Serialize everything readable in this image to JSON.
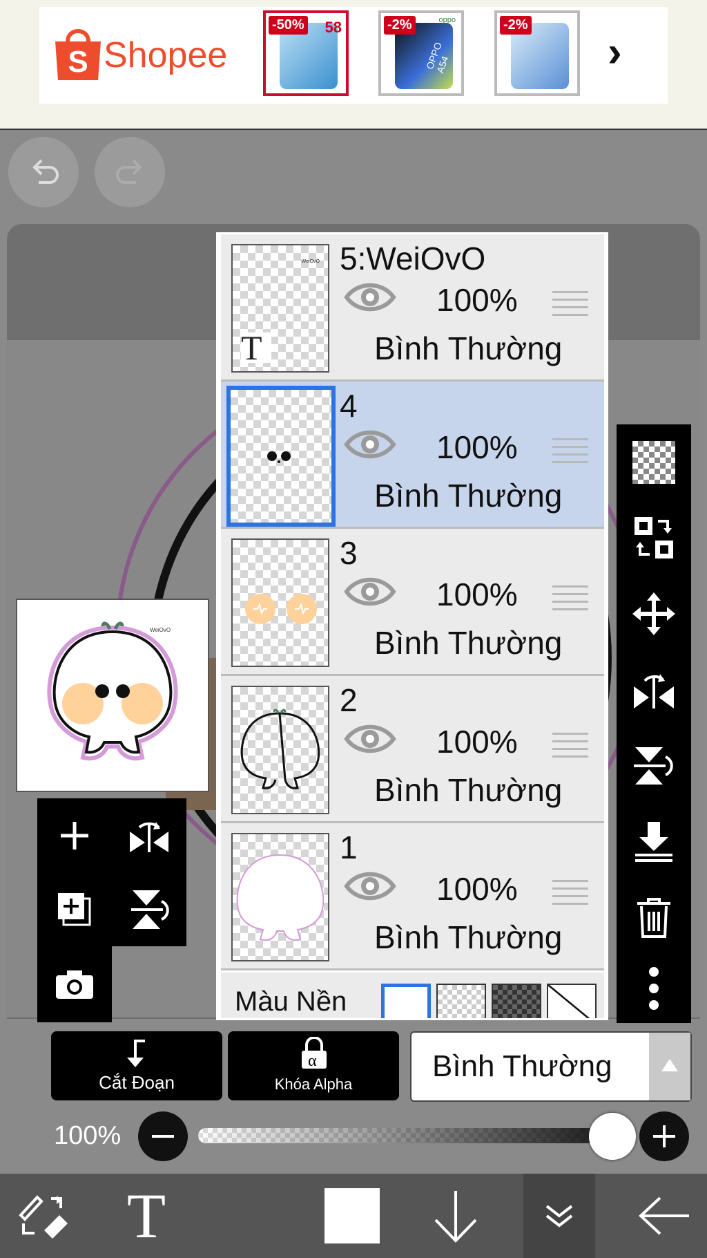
{
  "ad": {
    "brand": "Shopee",
    "items": [
      {
        "discount": "-50%",
        "price": "58"
      },
      {
        "discount": "-2%",
        "model": "OPPO A54",
        "brand_mark": "oppo"
      },
      {
        "discount": "-2%"
      }
    ],
    "next_icon": "chevron-right-icon"
  },
  "toolbar_top": {
    "undo_icon": "undo-icon",
    "redo_icon": "redo-icon"
  },
  "layers": [
    {
      "name": "5:WeiOvO",
      "opacity": "100%",
      "blend": "Bình Thường",
      "visible": true,
      "selected": false,
      "type_icon": "T",
      "thumb_text": "WeiOvO"
    },
    {
      "name": "4",
      "opacity": "100%",
      "blend": "Bình Thường",
      "visible": true,
      "selected": true
    },
    {
      "name": "3",
      "opacity": "100%",
      "blend": "Bình Thường",
      "visible": true,
      "selected": false
    },
    {
      "name": "2",
      "opacity": "100%",
      "blend": "Bình Thường",
      "visible": true,
      "selected": false
    },
    {
      "name": "1",
      "opacity": "100%",
      "blend": "Bình Thường",
      "visible": true,
      "selected": false
    }
  ],
  "background": {
    "label": "Màu Nền"
  },
  "preview": {
    "text": "WeiOvO"
  },
  "bottom_controls": {
    "clip_label": "Cắt Đoạn",
    "alpha_lock_label": "Khóa Alpha",
    "alpha_symbol": "α",
    "blend_mode": "Bình Thường"
  },
  "opacity": {
    "value_text": "100%",
    "value": 1.0
  },
  "colors": {
    "selected_layer_bg": "#c7d5ec",
    "selected_border": "#2d74e0",
    "shopee": "#ee4d2d",
    "toolbar": "#000000"
  },
  "bottom_nav": {
    "icons": [
      "transform-tool-icon",
      "text-tool-icon",
      "color-swatch-icon",
      "arrow-down-icon",
      "double-chevron-down-icon",
      "back-arrow-icon"
    ],
    "text_glyph": "T"
  }
}
